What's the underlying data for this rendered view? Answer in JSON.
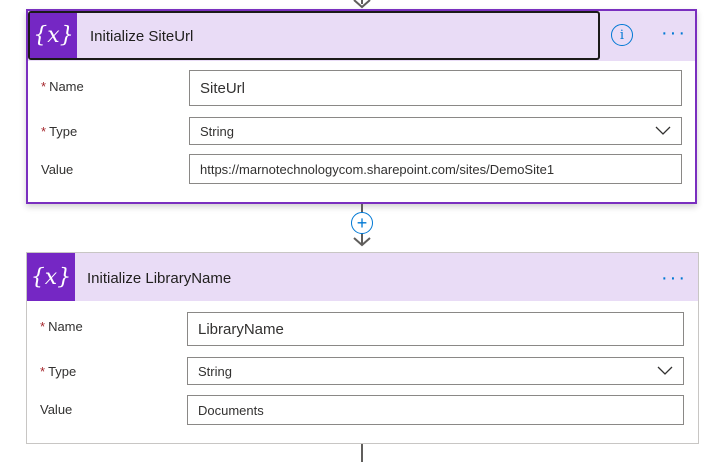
{
  "card1": {
    "title": "Initialize SiteUrl",
    "icon_text": "{x}",
    "name_label": "Name",
    "name_value": "SiteUrl",
    "type_label": "Type",
    "type_value": "String",
    "value_label": "Value",
    "value_value": "https://marnotechnologycom.sharepoint.com/sites/DemoSite1",
    "info_glyph": "i",
    "more_glyph": "···"
  },
  "card2": {
    "title": "Initialize LibraryName",
    "icon_text": "{x}",
    "name_label": "Name",
    "name_value": "LibraryName",
    "type_label": "Type",
    "type_value": "String",
    "value_label": "Value",
    "value_value": "Documents",
    "more_glyph": "···"
  },
  "connector": {
    "add_glyph": "+"
  },
  "required_marker": "*",
  "colors": {
    "accent": "#7527c4",
    "header_bg": "#e9dcf6",
    "link_blue": "#0078d4",
    "required": "#a4262c"
  }
}
